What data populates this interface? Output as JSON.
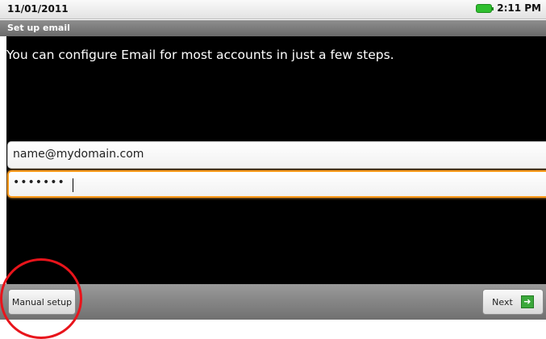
{
  "status_bar": {
    "date": "11/01/2011",
    "time": "2:11 PM",
    "battery_icon": "battery-icon"
  },
  "title_bar": {
    "title": "Set up email"
  },
  "main": {
    "instructions": "You can configure Email for most accounts in just a few steps.",
    "email_value": "name@mydomain.com",
    "password_value": "•••••••"
  },
  "bottom_bar": {
    "manual_setup_label": "Manual setup",
    "next_label": "Next",
    "next_icon": "arrow-right-icon"
  },
  "colors": {
    "focus_border": "#ff9a1a",
    "annotation_circle": "#e8141b",
    "next_icon_bg": "#3ba83b"
  }
}
